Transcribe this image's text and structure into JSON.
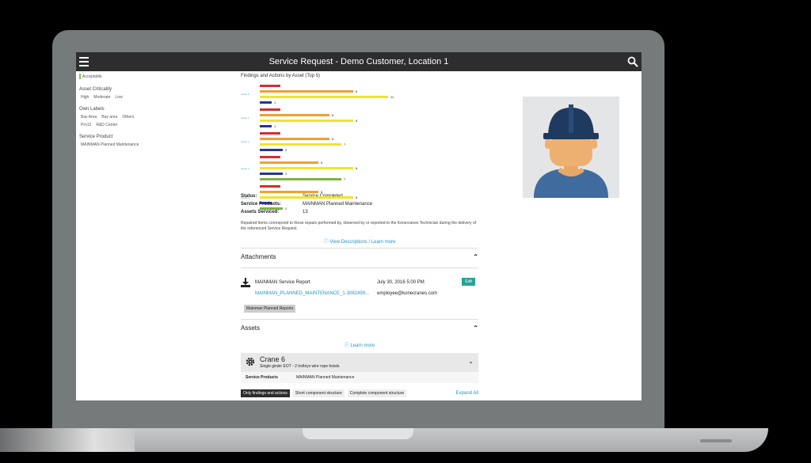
{
  "window": {
    "title": "Service Request - Demo Customer, Location 1"
  },
  "sidebar": {
    "acceptable_label": "Acceptable",
    "asset_criticality": {
      "heading": "Asset Criticality",
      "options": [
        "High",
        "Moderate",
        "Low"
      ]
    },
    "own_labels": {
      "heading": "Own Labels",
      "options": [
        "Bay Area",
        "Bay area",
        "Others",
        "Prn12",
        "R&D Center"
      ]
    },
    "service_product": {
      "heading": "Service Product",
      "options": [
        "MAINMAN Planned Maintenance"
      ]
    }
  },
  "main": {
    "chart_title": "Findings and Actions by Asset (Top 5)",
    "status_label": "Status:",
    "status_value": "Service Completed",
    "service_products_label": "Service Products:",
    "service_products_value": "MAINMAN Planned Maintenance",
    "assets_serviced_label": "Assets Serviced:",
    "assets_serviced_value": "13",
    "note": "Repaired Items correspond to those repairs performed by, observed by or reported to the Konecranes Technician during the delivery of the referenced Service Request.",
    "view_descriptions_link": "View Descriptions / Learn more"
  },
  "attachments": {
    "heading": "Attachments",
    "item_title": "MAINMAN Service Report",
    "item_date": "July 30, 2016 5:00 PM",
    "edit_label": "Edit",
    "file_name": "MAINMAN_PLANNED_MAINTENANCE_1-3082499...",
    "email": "employee@konecranes.com",
    "tag_label": "Mainman Planned Reports"
  },
  "assets": {
    "heading": "Assets",
    "learn_more": "Learn more",
    "crane_name": "Crane 6",
    "crane_desc": "Single girder EOT - 2 trolleys wire rope hoists",
    "service_products_label": "Service Products",
    "service_products_value": "MAINMAN Planned Maintenance",
    "filters": [
      "Only findings and actions",
      "Short component structure",
      "Complete component structure"
    ],
    "expand_all": "Expand All"
  },
  "colors": {
    "red": "#d32f2f",
    "orange": "#f0a030",
    "yellow": "#f2e426",
    "navy": "#283593",
    "green": "#7cb342",
    "link": "#2196c9"
  },
  "chart_data": {
    "type": "bar",
    "title": "Findings and Actions by Asset (Top 5)",
    "categories": [
      "Crane 6",
      "Crane 1",
      "Crane 2",
      "Crane 3",
      "Crane 4"
    ],
    "groups": [
      {
        "category": "Crane 6",
        "bars": [
          {
            "color": "red",
            "value": null
          },
          {
            "color": "orange",
            "value": 8
          },
          {
            "color": "yellow",
            "value": 11
          },
          {
            "color": "navy",
            "value": 1
          }
        ]
      },
      {
        "category": "Crane 1",
        "bars": [
          {
            "color": "red",
            "value": null
          },
          {
            "color": "orange",
            "value": 6
          },
          {
            "color": "yellow",
            "value": 8
          },
          {
            "color": "navy",
            "value": 1
          }
        ]
      },
      {
        "category": "Crane 2",
        "bars": [
          {
            "color": "red",
            "value": null
          },
          {
            "color": "orange",
            "value": 6
          },
          {
            "color": "yellow",
            "value": 7
          },
          {
            "color": "navy",
            "value": 2
          }
        ]
      },
      {
        "category": "Crane 3",
        "bars": [
          {
            "color": "red",
            "value": null
          },
          {
            "color": "orange",
            "value": 5
          },
          {
            "color": "yellow",
            "value": 8
          },
          {
            "color": "navy",
            "value": 2
          },
          {
            "color": "green",
            "value": 7
          }
        ]
      },
      {
        "category": "Crane 4",
        "bars": [
          {
            "color": "red",
            "value": null
          },
          {
            "color": "orange",
            "value": 5
          },
          {
            "color": "yellow",
            "value": 8
          },
          {
            "color": "navy",
            "value": 1
          },
          {
            "color": "green",
            "value": 2
          }
        ]
      }
    ]
  }
}
